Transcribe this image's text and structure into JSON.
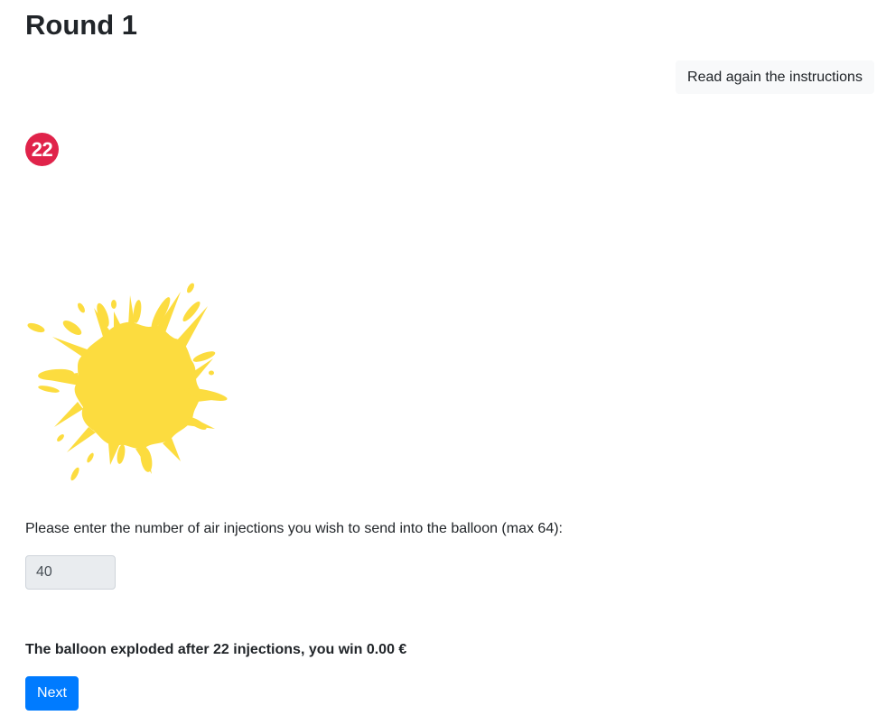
{
  "page": {
    "title": "Round 1"
  },
  "actions": {
    "instructions_label": "Read again the instructions",
    "next_label": "Next"
  },
  "balloon": {
    "explosion_count": "22",
    "state_icon": "balloon-burst-splat-icon",
    "splat_color": "#FCDC3F",
    "badge_color": "#E0234A"
  },
  "form": {
    "prompt": "Please enter the number of air injections you wish to send into the balloon (max 64):",
    "injections_value": "40"
  },
  "result": {
    "message": "The balloon exploded after 22 injections, you win 0.00 €"
  },
  "colors": {
    "primary": "#007BFF",
    "light_button": "#F8F9FA",
    "input_disabled_bg": "#E9ECEF"
  }
}
